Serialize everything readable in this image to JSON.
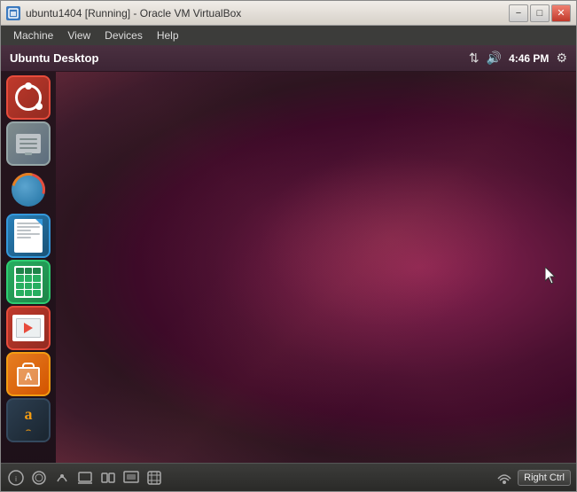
{
  "window": {
    "title": "ubuntu1404 [Running] - Oracle VM VirtualBox",
    "icon": "🖥️"
  },
  "title_bar": {
    "text": "ubuntu1404 [Running] - Oracle VM VirtualBox",
    "minimize": "−",
    "maximize": "□",
    "close": "✕"
  },
  "menu_bar": {
    "items": [
      {
        "id": "machine",
        "label": "Machine"
      },
      {
        "id": "view",
        "label": "View"
      },
      {
        "id": "devices",
        "label": "Devices"
      },
      {
        "id": "help",
        "label": "Help"
      }
    ]
  },
  "ubuntu_topbar": {
    "title": "Ubuntu Desktop",
    "clock": "4:46 PM",
    "icons": {
      "network": "⇅",
      "volume": "🔊",
      "gear": "⚙"
    }
  },
  "launcher": {
    "icons": [
      {
        "id": "ubuntu",
        "label": "Ubuntu Home"
      },
      {
        "id": "files",
        "label": "Files"
      },
      {
        "id": "firefox",
        "label": "Firefox"
      },
      {
        "id": "writer",
        "label": "LibreOffice Writer"
      },
      {
        "id": "calc",
        "label": "LibreOffice Calc"
      },
      {
        "id": "impress",
        "label": "LibreOffice Impress"
      },
      {
        "id": "appstore",
        "label": "Ubuntu Software Center"
      },
      {
        "id": "amazon",
        "label": "Amazon"
      }
    ]
  },
  "taskbar": {
    "right_ctrl": "Right Ctrl"
  }
}
